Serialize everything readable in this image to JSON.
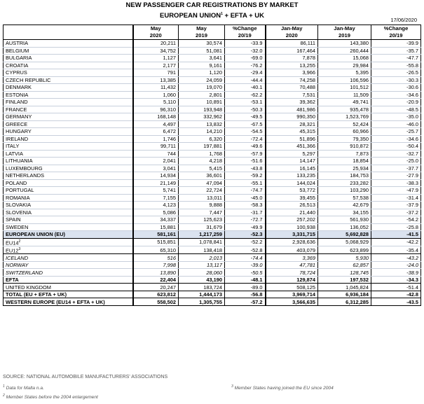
{
  "title_line1": "NEW PASSENGER CAR REGISTRATIONS BY MARKET",
  "title_line2": "EUROPEAN UNION",
  "title_line2_sup": "1",
  "title_line2_rest": " + EFTA + UK",
  "date": "17/06/2020",
  "headers": {
    "row1": [
      "May",
      "May",
      "%Change",
      "Jan-May",
      "Jan-May",
      "%Change"
    ],
    "row2": [
      "2020",
      "2019",
      "20/19",
      "2020",
      "2019",
      "20/19"
    ]
  },
  "rows": [
    {
      "name": "AUSTRIA",
      "v": [
        "20,211",
        "30,574",
        "-33.9",
        "86,111",
        "143,380",
        "-39.9"
      ]
    },
    {
      "name": "BELGIUM",
      "v": [
        "34,752",
        "51,081",
        "-32.0",
        "167,464",
        "260,444",
        "-35.7"
      ]
    },
    {
      "name": "BULGARIA",
      "v": [
        "1,127",
        "3,641",
        "-69.0",
        "7,878",
        "15,068",
        "-47.7"
      ]
    },
    {
      "name": "CROATIA",
      "v": [
        "2,177",
        "9,161",
        "-76.2",
        "13,255",
        "29,984",
        "-55.8"
      ]
    },
    {
      "name": "CYPRUS",
      "v": [
        "791",
        "1,120",
        "-29.4",
        "3,966",
        "5,395",
        "-26.5"
      ]
    },
    {
      "name": "CZECH REPUBLIC",
      "v": [
        "13,385",
        "24,059",
        "-44.4",
        "74,258",
        "106,596",
        "-30.3"
      ]
    },
    {
      "name": "DENMARK",
      "v": [
        "11,432",
        "19,070",
        "-40.1",
        "70,488",
        "101,512",
        "-30.6"
      ]
    },
    {
      "name": "ESTONIA",
      "v": [
        "1,060",
        "2,801",
        "-62.2",
        "7,531",
        "11,509",
        "-34.6"
      ]
    },
    {
      "name": "FINLAND",
      "v": [
        "5,110",
        "10,891",
        "-53.1",
        "39,362",
        "49,741",
        "-20.9"
      ]
    },
    {
      "name": "FRANCE",
      "v": [
        "96,310",
        "193,948",
        "-50.3",
        "481,986",
        "935,478",
        "-48.5"
      ]
    },
    {
      "name": "GERMANY",
      "v": [
        "168,148",
        "332,962",
        "-49.5",
        "990,350",
        "1,523,769",
        "-35.0"
      ]
    },
    {
      "name": "GREECE",
      "v": [
        "4,497",
        "13,832",
        "-67.5",
        "28,321",
        "52,424",
        "-46.0"
      ]
    },
    {
      "name": "HUNGARY",
      "v": [
        "6,472",
        "14,210",
        "-54.5",
        "45,315",
        "60,966",
        "-25.7"
      ]
    },
    {
      "name": "IRELAND",
      "v": [
        "1,746",
        "6,320",
        "-72.4",
        "51,896",
        "79,350",
        "-34.6"
      ]
    },
    {
      "name": "ITALY",
      "v": [
        "99,711",
        "197,881",
        "-49.6",
        "451,366",
        "910,872",
        "-50.4"
      ]
    },
    {
      "name": "LATVIA",
      "v": [
        "744",
        "1,768",
        "-57.9",
        "5,297",
        "7,873",
        "-32.7"
      ]
    },
    {
      "name": "LITHUANIA",
      "v": [
        "2,041",
        "4,218",
        "-51.6",
        "14,147",
        "18,854",
        "-25.0"
      ]
    },
    {
      "name": "LUXEMBOURG",
      "v": [
        "3,041",
        "5,415",
        "-43.8",
        "16,145",
        "25,934",
        "-37.7"
      ]
    },
    {
      "name": "NETHERLANDS",
      "v": [
        "14,934",
        "36,601",
        "-59.2",
        "133,235",
        "184,753",
        "-27.9"
      ]
    },
    {
      "name": "POLAND",
      "v": [
        "21,149",
        "47,094",
        "-55.1",
        "144,024",
        "233,282",
        "-38.3"
      ]
    },
    {
      "name": "PORTUGAL",
      "v": [
        "5,741",
        "22,724",
        "-74.7",
        "53,772",
        "103,290",
        "-47.9"
      ]
    },
    {
      "name": "ROMANIA",
      "v": [
        "7,155",
        "13,011",
        "-45.0",
        "39,455",
        "57,538",
        "-31.4"
      ]
    },
    {
      "name": "SLOVAKIA",
      "v": [
        "4,123",
        "9,888",
        "-58.3",
        "26,513",
        "42,679",
        "-37.9"
      ]
    },
    {
      "name": "SLOVENIA",
      "v": [
        "5,086",
        "7,447",
        "-31.7",
        "21,440",
        "34,155",
        "-37.2"
      ]
    },
    {
      "name": "SPAIN",
      "v": [
        "34,337",
        "125,623",
        "-72.7",
        "257,202",
        "561,930",
        "-54.2"
      ]
    },
    {
      "name": "SWEDEN",
      "v": [
        "15,881",
        "31,679",
        "-49.9",
        "100,938",
        "136,052",
        "-25.8"
      ]
    }
  ],
  "eu_total": {
    "name": "EUROPEAN UNION (EU)",
    "v": [
      "581,161",
      "1,217,259",
      "-52.3",
      "3,331,715",
      "5,692,828",
      "-41.5"
    ]
  },
  "eu14": {
    "name": "EU14",
    "sup": "2",
    "v": [
      "515,851",
      "1,078,841",
      "-52.2",
      "2,928,636",
      "5,068,929",
      "-42.2"
    ]
  },
  "eu12": {
    "name": "EU12",
    "sup": "3",
    "v": [
      "65,310",
      "138,418",
      "-52.8",
      "403,079",
      "623,899",
      "-35.4"
    ]
  },
  "efta_rows": [
    {
      "name": "ICELAND",
      "v": [
        "516",
        "2,013",
        "-74.4",
        "3,369",
        "5,930",
        "-43.2"
      ]
    },
    {
      "name": "NORWAY",
      "v": [
        "7,998",
        "13,117",
        "-39.0",
        "47,781",
        "62,857",
        "-24.0"
      ]
    },
    {
      "name": "SWITZERLAND",
      "v": [
        "13,890",
        "28,060",
        "-50.5",
        "78,724",
        "128,745",
        "-38.9"
      ]
    }
  ],
  "efta_total": {
    "name": "EFTA",
    "v": [
      "22,404",
      "43,190",
      "-48.1",
      "129,874",
      "197,532",
      "-34.3"
    ]
  },
  "uk": {
    "name": "UNITED KINGDOM",
    "v": [
      "20,247",
      "183,724",
      "-89.0",
      "508,125",
      "1,045,824",
      "-51.4"
    ]
  },
  "total_eu_efta_uk": {
    "name": "TOTAL (EU + EFTA + UK)",
    "v": [
      "623,812",
      "1,444,173",
      "-56.8",
      "3,969,714",
      "6,936,184",
      "-42.8"
    ]
  },
  "western_europe": {
    "name": "WESTERN EUROPE (EU14 + EFTA + UK)",
    "v": [
      "558,502",
      "1,305,755",
      "-57.2",
      "3,566,635",
      "6,312,285",
      "-43.5"
    ]
  },
  "source": "SOURCE: NATIONAL AUTOMOBILE MANUFACTURERS' ASSOCIATIONS",
  "footnotes": {
    "f1": "Data for Malta n.a.",
    "f2": "Member States before the 2004 enlargement",
    "f3": "Member States having joined the EU since 2004"
  }
}
